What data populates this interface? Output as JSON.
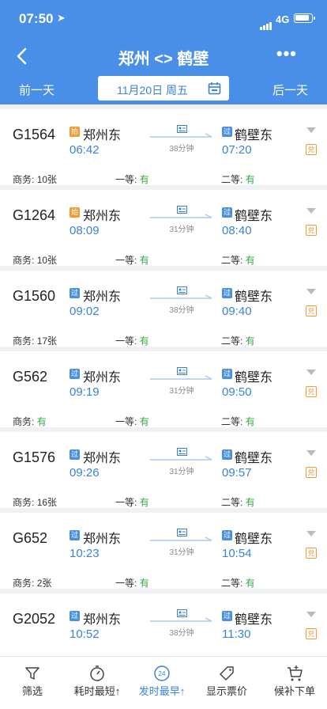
{
  "status_bar": {
    "time": "07:50",
    "network": "4G"
  },
  "navbar": {
    "title": "郑州 <> 鹤壁"
  },
  "date_bar": {
    "prev_label": "前一天",
    "date": "11月20日 周五",
    "next_label": "后一天"
  },
  "colors": {
    "header_blue": "#4a8fe7",
    "time_blue": "#3b82d6",
    "available_green": "#35a845",
    "start_orange": "#f29a35"
  },
  "seat_labels": {
    "business": "商务:",
    "first": "一等:",
    "second": "二等:"
  },
  "trains": [
    {
      "no": "G1564",
      "from_tag": "始",
      "from": "郑州东",
      "dep": "06:42",
      "duration": "38分钟",
      "to_tag": "过",
      "to": "鹤壁东",
      "arr": "07:20",
      "exchange": "兑",
      "business": "10张",
      "first": "有",
      "second": "有"
    },
    {
      "no": "G1264",
      "from_tag": "始",
      "from": "郑州东",
      "dep": "08:09",
      "duration": "31分钟",
      "to_tag": "过",
      "to": "鹤壁东",
      "arr": "08:40",
      "exchange": "兑",
      "business": "10张",
      "first": "有",
      "second": "有"
    },
    {
      "no": "G1560",
      "from_tag": "过",
      "from": "郑州东",
      "dep": "09:02",
      "duration": "38分钟",
      "to_tag": "过",
      "to": "鹤壁东",
      "arr": "09:40",
      "exchange": "兑",
      "business": "17张",
      "first": "有",
      "second": "有"
    },
    {
      "no": "G562",
      "from_tag": "过",
      "from": "郑州东",
      "dep": "09:19",
      "duration": "31分钟",
      "to_tag": "过",
      "to": "鹤壁东",
      "arr": "09:50",
      "exchange": "兑",
      "business": "有",
      "first": "有",
      "second": "有"
    },
    {
      "no": "G1576",
      "from_tag": "过",
      "from": "郑州东",
      "dep": "09:26",
      "duration": "31分钟",
      "to_tag": "过",
      "to": "鹤壁东",
      "arr": "09:57",
      "exchange": "兑",
      "business": "16张",
      "first": "有",
      "second": "有"
    },
    {
      "no": "G652",
      "from_tag": "过",
      "from": "郑州东",
      "dep": "10:23",
      "duration": "31分钟",
      "to_tag": "过",
      "to": "鹤壁东",
      "arr": "10:54",
      "exchange": "兑",
      "business": "2张",
      "first": "有",
      "second": "有"
    },
    {
      "no": "G2052",
      "from_tag": "过",
      "from": "郑州东",
      "dep": "10:52",
      "duration": "38分钟",
      "to_tag": "过",
      "to": "鹤壁东",
      "arr": "11:30",
      "exchange": "兑",
      "business": "",
      "first": "",
      "second": ""
    }
  ],
  "tabbar": {
    "filter": "筛选",
    "shortest": "耗时最短↑",
    "earliest_badge": "24",
    "earliest": "发时最早↑",
    "price": "显示票价",
    "waitlist": "候补下单"
  }
}
